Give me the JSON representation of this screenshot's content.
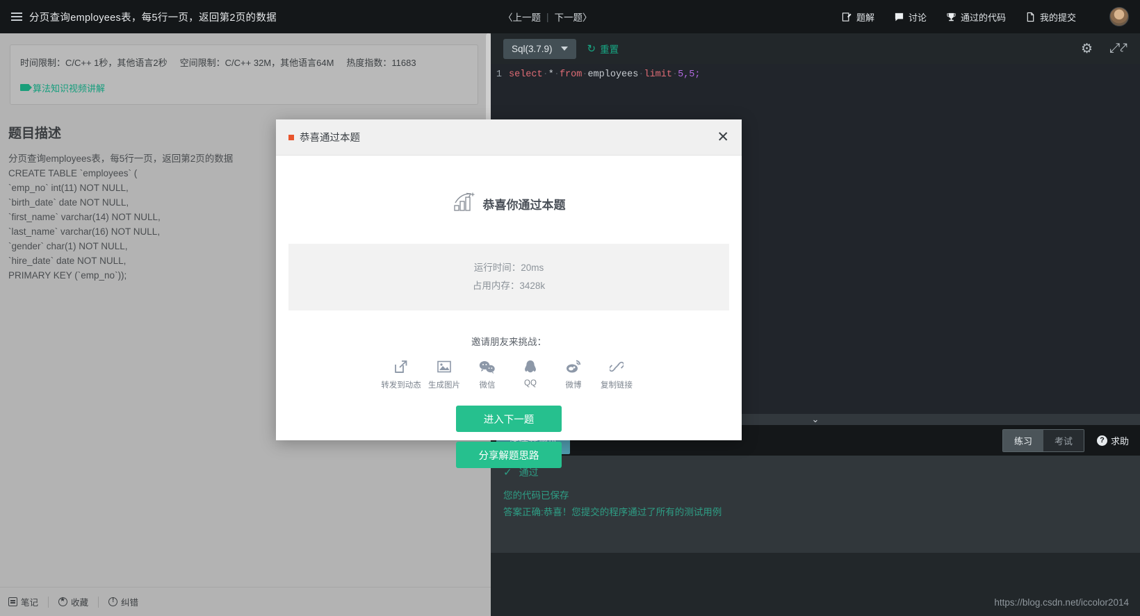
{
  "left": {
    "header": {
      "menu_icon": "hamburger-icon",
      "title": "分页查询employees表，每5行一页，返回第2页的数据"
    },
    "info": {
      "time_limit": "时间限制：C/C++ 1秒，其他语言2秒",
      "space_limit": "空间限制：C/C++ 32M，其他语言64M",
      "heat": "热度指数：11683",
      "video_link": "算法知识视频讲解",
      "video_icon": "video-camera-icon"
    },
    "description": {
      "title": "题目描述",
      "body": "分页查询employees表，每5行一页，返回第2页的数据\nCREATE TABLE `employees` (\n`emp_no` int(11) NOT NULL,\n`birth_date` date NOT NULL,\n`first_name` varchar(14) NOT NULL,\n`last_name` varchar(16) NOT NULL,\n`gender` char(1) NOT NULL,\n`hire_date` date NOT NULL,\nPRIMARY KEY (`emp_no`));"
    },
    "footer": [
      {
        "label": "笔记",
        "icon": "note-icon"
      },
      {
        "label": "收藏",
        "icon": "star-icon"
      },
      {
        "label": "纠错",
        "icon": "error-report-icon"
      }
    ]
  },
  "right": {
    "nav": {
      "prev": "〈上一题",
      "divider": "|",
      "next": "下一题〉",
      "items": [
        {
          "label": "题解",
          "icon": "solution-pencil-icon"
        },
        {
          "label": "讨论",
          "icon": "comment-bubble-icon"
        },
        {
          "label": "通过的代码",
          "icon": "trophy-icon"
        },
        {
          "label": "我的提交",
          "icon": "document-icon"
        }
      ],
      "avatar": "user-avatar"
    },
    "toolbar": {
      "language": "Sql(3.7.9)",
      "chevron": "chevron-down-icon",
      "reset_label": "重置",
      "reset_icon": "refresh-icon",
      "settings_icon": "gear-icon",
      "fullscreen_icon": "expand-icon"
    },
    "editor": {
      "line_number": "1",
      "tokens": [
        {
          "t": "select",
          "k": "kw"
        },
        {
          "t": "·",
          "k": "dot"
        },
        {
          "t": "*",
          "k": "op"
        },
        {
          "t": "·",
          "k": "dot"
        },
        {
          "t": "from",
          "k": "kw"
        },
        {
          "t": "·",
          "k": "dot"
        },
        {
          "t": "employees",
          "k": "id"
        },
        {
          "t": "·",
          "k": "dot"
        },
        {
          "t": "limit",
          "k": "kw"
        },
        {
          "t": "·",
          "k": "dot"
        },
        {
          "t": "5,5;",
          "k": "num"
        }
      ],
      "code_plain": "select * from employees limit 5,5;",
      "collapse_icon": "chevron-down-icon"
    },
    "run_bar": {
      "save_debug": "保存并调试",
      "mode_practice": "练习",
      "mode_exam": "考试",
      "help": "求助",
      "help_icon": "question-mark-icon"
    },
    "result": {
      "status": "通过",
      "status_icon": "check-icon",
      "line1": "您的代码已保存",
      "line2": "答案正确:恭喜！您提交的程序通过了所有的测试用例"
    },
    "watermark": "https://blog.csdn.net/iccolor2014"
  },
  "modal": {
    "title": "恭喜通过本题",
    "close_icon": "close-icon",
    "congrat_text": "恭喜你通过本题",
    "congrat_icon": "growth-chart-icon",
    "stats": [
      "运行时间：20ms",
      "占用内存：3428k"
    ],
    "invite_label": "邀请朋友来挑战：",
    "share": [
      {
        "label": "转发到动态",
        "icon": "share-external-icon"
      },
      {
        "label": "生成图片",
        "icon": "image-icon"
      },
      {
        "label": "微信",
        "icon": "wechat-icon"
      },
      {
        "label": "QQ",
        "icon": "qq-icon"
      },
      {
        "label": "微博",
        "icon": "weibo-icon"
      },
      {
        "label": "复制链接",
        "icon": "link-icon"
      }
    ],
    "next_button": "进入下一题",
    "share_button": "分享解题思路"
  },
  "colors": {
    "accent_green": "#26c08e",
    "link_green": "#149d7c",
    "marker_orange": "#e8552d",
    "save_blue": "#4f9aad"
  }
}
